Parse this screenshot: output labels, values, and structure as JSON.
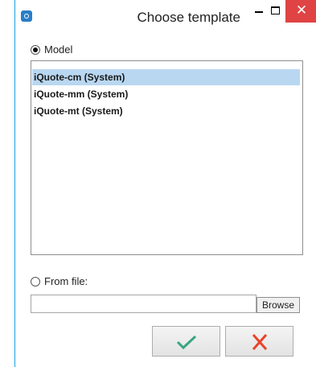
{
  "window": {
    "title": "Choose template"
  },
  "model_option": {
    "label": "Model",
    "selected": true
  },
  "model_list": {
    "items": [
      {
        "label": "iQuote-cm (System)",
        "selected": true
      },
      {
        "label": "iQuote-mm (System)",
        "selected": false
      },
      {
        "label": "iQuote-mt (System)",
        "selected": false
      }
    ]
  },
  "file_option": {
    "label": "From file:",
    "selected": false
  },
  "file_input": {
    "value": "",
    "placeholder": ""
  },
  "browse_button": {
    "label": "Browse"
  },
  "icons": {
    "app": "app-logo-icon",
    "minimize": "minimize-icon",
    "maximize": "maximize-icon",
    "close": "close-icon",
    "ok": "checkmark-icon",
    "cancel": "cross-icon"
  },
  "colors": {
    "close_button": "#e04343",
    "selection": "#b9d7f1",
    "checkmark": "#3aa57f",
    "cross": "#e8442a",
    "window_border": "#1ba1e2"
  }
}
